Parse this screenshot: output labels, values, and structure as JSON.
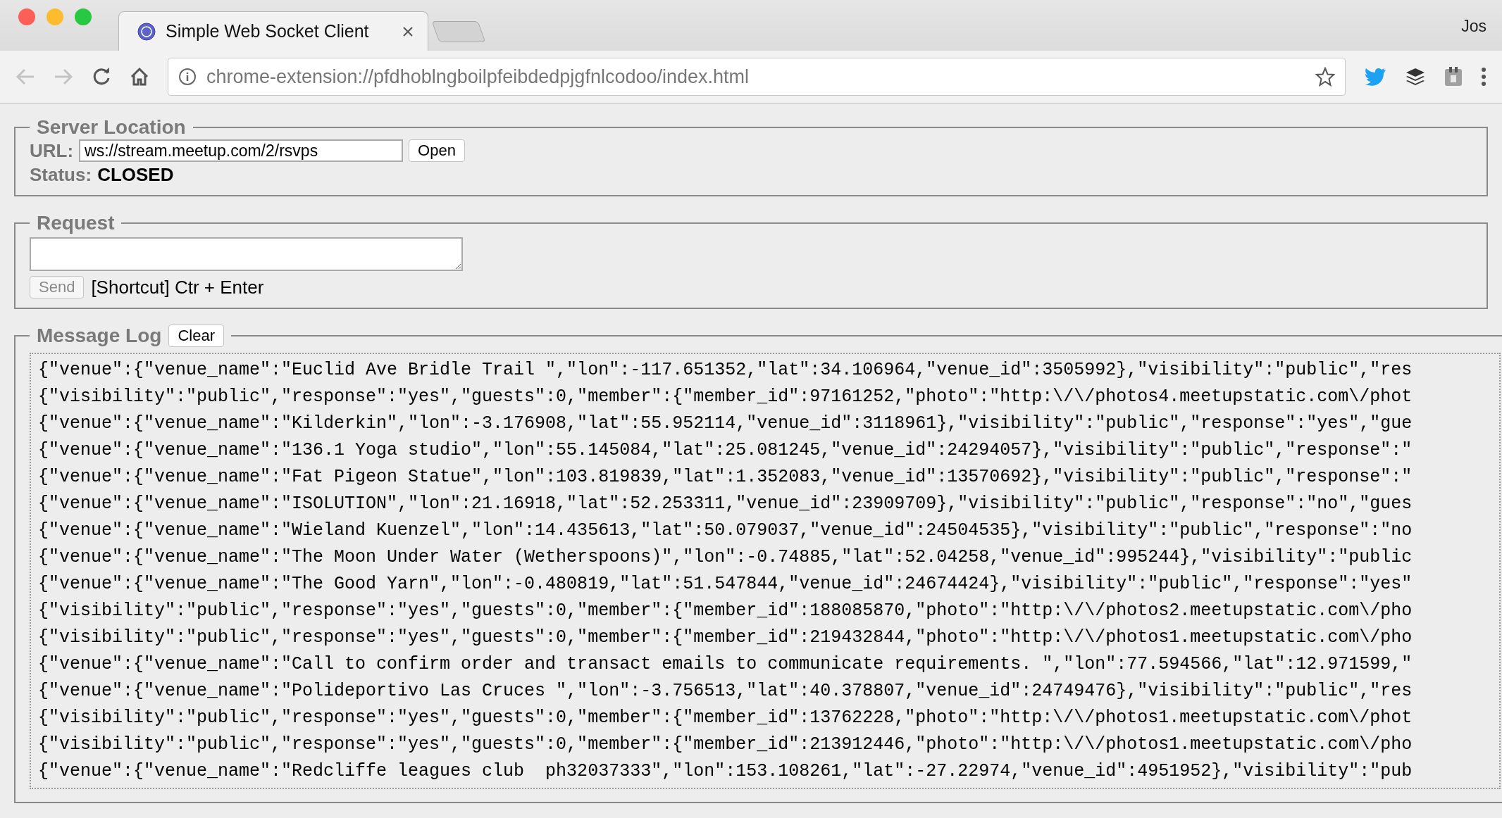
{
  "browser": {
    "tab": {
      "title": "Simple Web Socket Client",
      "selected": true
    },
    "profile": "Jos",
    "back": {
      "disabled": true
    },
    "forward": {
      "disabled": true
    },
    "address": "chrome-extension://pfdhoblngboilpfeibdedpjgfnlcodoo/index.html"
  },
  "server_location": {
    "legend": "Server Location",
    "url_label": "URL:",
    "url_value": "ws://stream.meetup.com/2/rsvps",
    "open_button": "Open",
    "status_label": "Status:",
    "status_value": "CLOSED"
  },
  "request": {
    "legend": "Request",
    "send_button": {
      "label": "Send",
      "disabled": true
    },
    "shortcut": "[Shortcut] Ctr + Enter"
  },
  "message_log": {
    "legend": "Message Log",
    "clear_button": "Clear",
    "lines": [
      "{\"venue\":{\"venue_name\":\"Euclid Ave Bridle Trail \",\"lon\":-117.651352,\"lat\":34.106964,\"venue_id\":3505992},\"visibility\":\"public\",\"res",
      "{\"visibility\":\"public\",\"response\":\"yes\",\"guests\":0,\"member\":{\"member_id\":97161252,\"photo\":\"http:\\/\\/photos4.meetupstatic.com\\/phot",
      "{\"venue\":{\"venue_name\":\"Kilderkin\",\"lon\":-3.176908,\"lat\":55.952114,\"venue_id\":3118961},\"visibility\":\"public\",\"response\":\"yes\",\"gue",
      "{\"venue\":{\"venue_name\":\"136.1 Yoga studio\",\"lon\":55.145084,\"lat\":25.081245,\"venue_id\":24294057},\"visibility\":\"public\",\"response\":\"",
      "{\"venue\":{\"venue_name\":\"Fat Pigeon Statue\",\"lon\":103.819839,\"lat\":1.352083,\"venue_id\":13570692},\"visibility\":\"public\",\"response\":\"",
      "{\"venue\":{\"venue_name\":\"ISOLUTION\",\"lon\":21.16918,\"lat\":52.253311,\"venue_id\":23909709},\"visibility\":\"public\",\"response\":\"no\",\"gues",
      "{\"venue\":{\"venue_name\":\"Wieland Kuenzel\",\"lon\":14.435613,\"lat\":50.079037,\"venue_id\":24504535},\"visibility\":\"public\",\"response\":\"no",
      "{\"venue\":{\"venue_name\":\"The Moon Under Water (Wetherspoons)\",\"lon\":-0.74885,\"lat\":52.04258,\"venue_id\":995244},\"visibility\":\"public",
      "{\"venue\":{\"venue_name\":\"The Good Yarn\",\"lon\":-0.480819,\"lat\":51.547844,\"venue_id\":24674424},\"visibility\":\"public\",\"response\":\"yes\"",
      "{\"visibility\":\"public\",\"response\":\"yes\",\"guests\":0,\"member\":{\"member_id\":188085870,\"photo\":\"http:\\/\\/photos2.meetupstatic.com\\/pho",
      "{\"visibility\":\"public\",\"response\":\"yes\",\"guests\":0,\"member\":{\"member_id\":219432844,\"photo\":\"http:\\/\\/photos1.meetupstatic.com\\/pho",
      "{\"venue\":{\"venue_name\":\"Call to confirm order and transact emails to communicate requirements. \",\"lon\":77.594566,\"lat\":12.971599,\"",
      "{\"venue\":{\"venue_name\":\"Polideportivo Las Cruces \",\"lon\":-3.756513,\"lat\":40.378807,\"venue_id\":24749476},\"visibility\":\"public\",\"res",
      "{\"visibility\":\"public\",\"response\":\"yes\",\"guests\":0,\"member\":{\"member_id\":13762228,\"photo\":\"http:\\/\\/photos1.meetupstatic.com\\/phot",
      "{\"visibility\":\"public\",\"response\":\"yes\",\"guests\":0,\"member\":{\"member_id\":213912446,\"photo\":\"http:\\/\\/photos1.meetupstatic.com\\/pho",
      "{\"venue\":{\"venue_name\":\"Redcliffe leagues club  ph32037333\",\"lon\":153.108261,\"lat\":-27.22974,\"venue_id\":4951952},\"visibility\":\"pub"
    ]
  }
}
